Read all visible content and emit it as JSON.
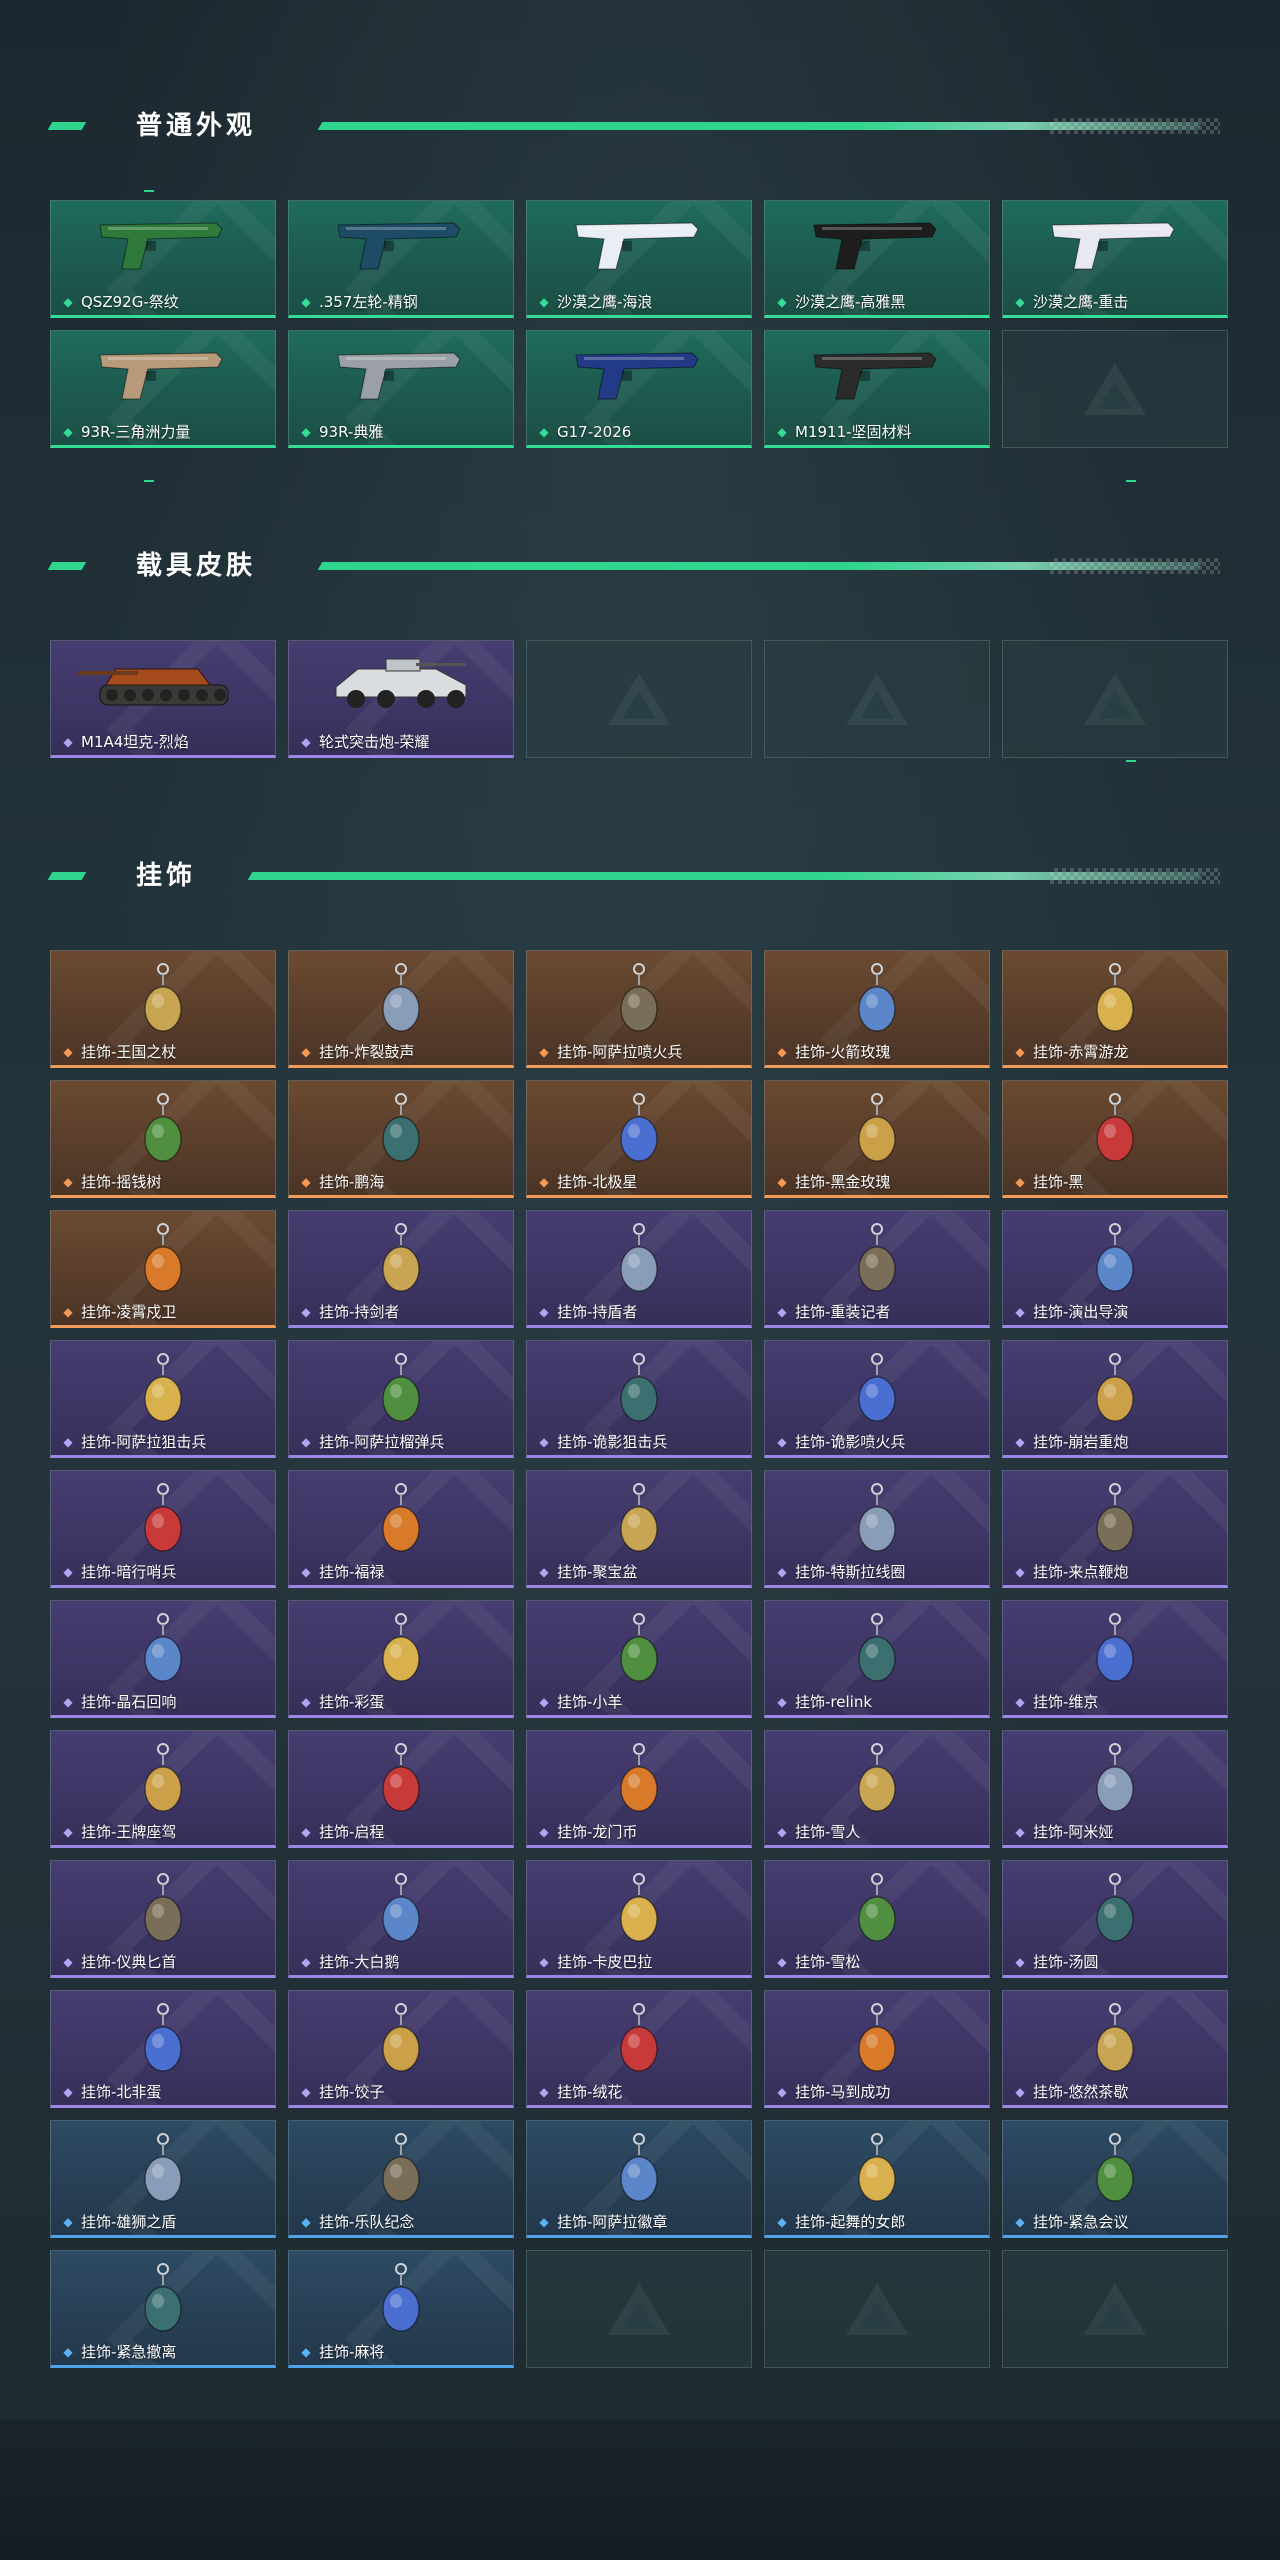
{
  "colors": {
    "accent_green": "#2fd58e",
    "rarity_green": "#34dd96",
    "rarity_purple": "#9b86e6",
    "rarity_orange": "#f09b58",
    "rarity_blue": "#4fa2e8"
  },
  "sections": {
    "weapons": {
      "title": "普通外观",
      "items": [
        {
          "label": "QSZ92G-祭纹",
          "rarity": "green",
          "icon": "pistol-green-icon"
        },
        {
          "label": ".357左轮-精钢",
          "rarity": "green",
          "icon": "revolver-icon"
        },
        {
          "label": "沙漠之鹰-海浪",
          "rarity": "green",
          "icon": "pistol-wave-icon"
        },
        {
          "label": "沙漠之鹰-高雅黑",
          "rarity": "green",
          "icon": "pistol-black-icon"
        },
        {
          "label": "沙漠之鹰-重击",
          "rarity": "green",
          "icon": "pistol-white-icon"
        },
        {
          "label": "93R-三角洲力量",
          "rarity": "green",
          "icon": "pistol-tan-icon"
        },
        {
          "label": "93R-典雅",
          "rarity": "green",
          "icon": "pistol-silver-icon"
        },
        {
          "label": "G17-2026",
          "rarity": "green",
          "icon": "pistol-blue-icon"
        },
        {
          "label": "M1911-坚固材料",
          "rarity": "green",
          "icon": "pistol-dark-icon"
        }
      ]
    },
    "vehicles": {
      "title": "载具皮肤",
      "items": [
        {
          "label": "M1A4坦克-烈焰",
          "rarity": "purple",
          "icon": "tank-icon"
        },
        {
          "label": "轮式突击炮-荣耀",
          "rarity": "purple",
          "icon": "armored-vehicle-icon"
        }
      ]
    },
    "charms": {
      "title": "挂饰",
      "items": [
        {
          "label": "挂饰-王国之杖",
          "rarity": "orange"
        },
        {
          "label": "挂饰-炸裂鼓声",
          "rarity": "orange"
        },
        {
          "label": "挂饰-阿萨拉喷火兵",
          "rarity": "orange"
        },
        {
          "label": "挂饰-火箭玫瑰",
          "rarity": "orange"
        },
        {
          "label": "挂饰-赤霄游龙",
          "rarity": "orange"
        },
        {
          "label": "挂饰-摇钱树",
          "rarity": "orange"
        },
        {
          "label": "挂饰-鹏海",
          "rarity": "orange"
        },
        {
          "label": "挂饰-北极星",
          "rarity": "orange"
        },
        {
          "label": "挂饰-黑金玫瑰",
          "rarity": "orange"
        },
        {
          "label": "挂饰-黑",
          "rarity": "orange"
        },
        {
          "label": "挂饰-凌霄戍卫",
          "rarity": "orange"
        },
        {
          "label": "挂饰-持剑者",
          "rarity": "purple"
        },
        {
          "label": "挂饰-持盾者",
          "rarity": "purple"
        },
        {
          "label": "挂饰-重装记者",
          "rarity": "purple"
        },
        {
          "label": "挂饰-演出导演",
          "rarity": "purple"
        },
        {
          "label": "挂饰-阿萨拉狙击兵",
          "rarity": "purple"
        },
        {
          "label": "挂饰-阿萨拉榴弹兵",
          "rarity": "purple"
        },
        {
          "label": "挂饰-诡影狙击兵",
          "rarity": "purple"
        },
        {
          "label": "挂饰-诡影喷火兵",
          "rarity": "purple"
        },
        {
          "label": "挂饰-崩岩重炮",
          "rarity": "purple"
        },
        {
          "label": "挂饰-暗行哨兵",
          "rarity": "purple"
        },
        {
          "label": "挂饰-福禄",
          "rarity": "purple"
        },
        {
          "label": "挂饰-聚宝盆",
          "rarity": "purple"
        },
        {
          "label": "挂饰-特斯拉线圈",
          "rarity": "purple"
        },
        {
          "label": "挂饰-来点鞭炮",
          "rarity": "purple"
        },
        {
          "label": "挂饰-晶石回响",
          "rarity": "purple"
        },
        {
          "label": "挂饰-彩蛋",
          "rarity": "purple"
        },
        {
          "label": "挂饰-小羊",
          "rarity": "purple"
        },
        {
          "label": "挂饰-relink",
          "rarity": "purple"
        },
        {
          "label": "挂饰-维京",
          "rarity": "purple"
        },
        {
          "label": "挂饰-王牌座驾",
          "rarity": "purple"
        },
        {
          "label": "挂饰-启程",
          "rarity": "purple"
        },
        {
          "label": "挂饰-龙门币",
          "rarity": "purple"
        },
        {
          "label": "挂饰-雪人",
          "rarity": "purple"
        },
        {
          "label": "挂饰-阿米娅",
          "rarity": "purple"
        },
        {
          "label": "挂饰-仪典匕首",
          "rarity": "purple"
        },
        {
          "label": "挂饰-大白鹅",
          "rarity": "purple"
        },
        {
          "label": "挂饰-卡皮巴拉",
          "rarity": "purple"
        },
        {
          "label": "挂饰-雪松",
          "rarity": "purple"
        },
        {
          "label": "挂饰-汤圆",
          "rarity": "purple"
        },
        {
          "label": "挂饰-北非蛋",
          "rarity": "purple"
        },
        {
          "label": "挂饰-饺子",
          "rarity": "purple"
        },
        {
          "label": "挂饰-绒花",
          "rarity": "purple"
        },
        {
          "label": "挂饰-马到成功",
          "rarity": "purple"
        },
        {
          "label": "挂饰-悠然茶歇",
          "rarity": "purple"
        },
        {
          "label": "挂饰-雄狮之盾",
          "rarity": "blue"
        },
        {
          "label": "挂饰-乐队纪念",
          "rarity": "blue"
        },
        {
          "label": "挂饰-阿萨拉徽章",
          "rarity": "blue"
        },
        {
          "label": "挂饰-起舞的女郎",
          "rarity": "blue"
        },
        {
          "label": "挂饰-紧急会议",
          "rarity": "blue"
        },
        {
          "label": "挂饰-紧急撤离",
          "rarity": "blue"
        },
        {
          "label": "挂饰-麻将",
          "rarity": "blue"
        }
      ]
    }
  }
}
